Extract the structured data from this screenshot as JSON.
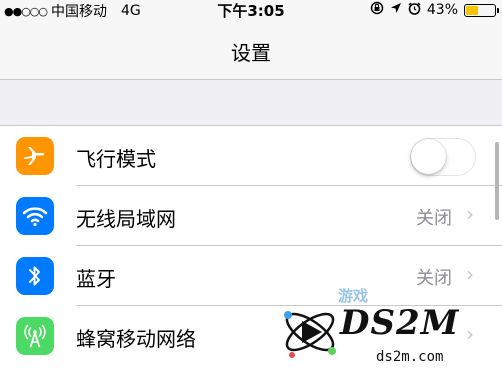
{
  "status_bar": {
    "signal_dots": "●●○○○",
    "carrier": "中国移动",
    "network": "4G",
    "time": "下午3:05",
    "icons": [
      "rotation-lock-icon",
      "location-arrow-icon",
      "alarm-icon"
    ],
    "battery_percent": "43%",
    "battery_level": 0.43,
    "battery_color": "#f5c400"
  },
  "nav": {
    "title": "设置"
  },
  "settings": {
    "items": [
      {
        "label": "飞行模式",
        "icon": "airplane-icon",
        "icon_bg": "#ff9500",
        "control": "toggle",
        "toggle_on": false
      },
      {
        "label": "无线局域网",
        "icon": "wifi-icon",
        "icon_bg": "#007aff",
        "value": "关闭",
        "control": "chevron"
      },
      {
        "label": "蓝牙",
        "icon": "bluetooth-icon",
        "icon_bg": "#007aff",
        "value": "关闭",
        "control": "chevron"
      },
      {
        "label": "蜂窝移动网络",
        "icon": "cellular-icon",
        "icon_bg": "#4cd964",
        "control": "chevron"
      }
    ]
  },
  "watermark": {
    "top": "游戏",
    "brand": "DS2M",
    "url": "ds2m.com"
  }
}
